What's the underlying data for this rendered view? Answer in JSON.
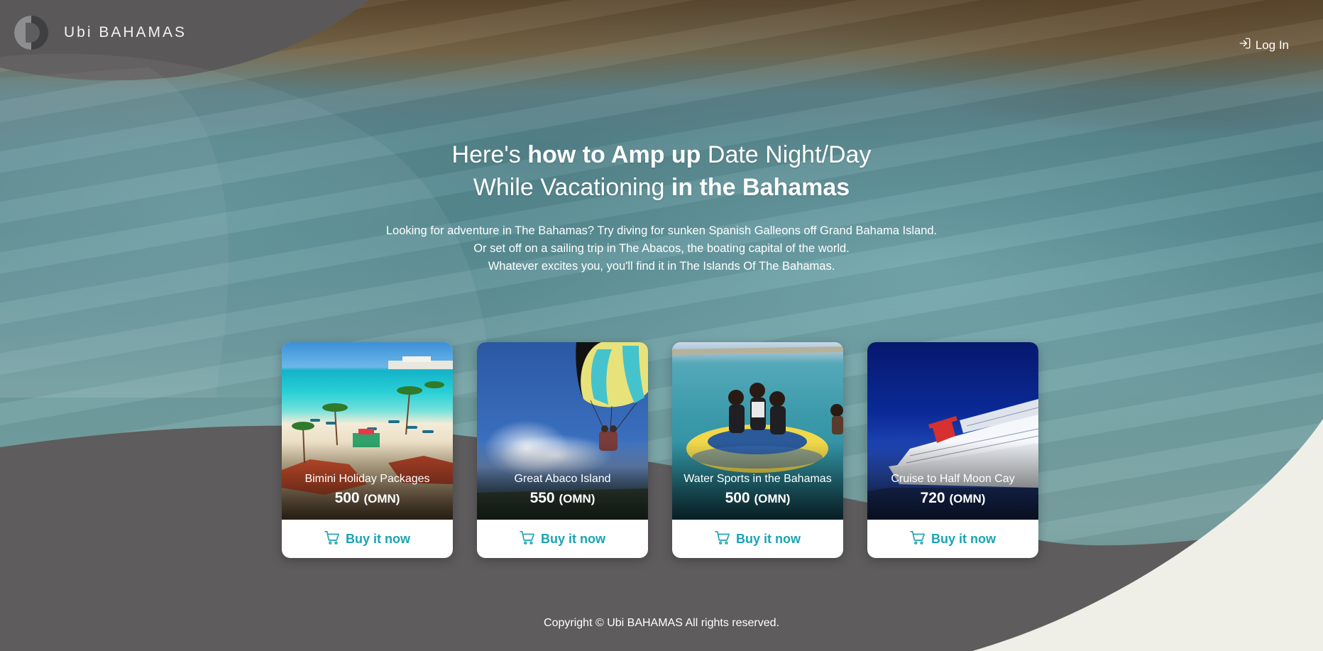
{
  "brand": {
    "name": "Ubi BAHAMAS"
  },
  "header": {
    "login_label": "Log In"
  },
  "hero": {
    "title_line1_pre": "Here's ",
    "title_line1_bold": "how to Amp up",
    "title_line1_post": " Date Night/Day",
    "title_line2_pre": "While Vacationing ",
    "title_line2_bold": "in the Bahamas",
    "desc_lines": [
      "Looking for adventure in The Bahamas? Try diving for sunken Spanish Galleons off Grand Bahama Island.",
      "Or set off on a sailing trip in The Abacos, the boating capital of the world.",
      "Whatever excites you, you'll find it in The Islands Of The Bahamas."
    ]
  },
  "cards": [
    {
      "title": "Bimini Holiday Packages",
      "price": "500",
      "currency": "(OMN)",
      "buy_label": "Buy it now",
      "image": "beach-resort"
    },
    {
      "title": "Great Abaco Island",
      "price": "550",
      "currency": "(OMN)",
      "buy_label": "Buy it now",
      "image": "parasailing"
    },
    {
      "title": "Water Sports in the Bahamas",
      "price": "500",
      "currency": "(OMN)",
      "buy_label": "Buy it now",
      "image": "tube-riders"
    },
    {
      "title": "Cruise to Half Moon Cay",
      "price": "720",
      "currency": "(OMN)",
      "buy_label": "Buy it now",
      "image": "cruise-ship"
    }
  ],
  "footer": {
    "copyright": "Copyright © Ubi BAHAMAS All rights reserved."
  },
  "colors": {
    "accent": "#1ba3b3",
    "dark_band": "#5e5c5d",
    "light_corner": "#efefe8"
  },
  "icons": {
    "login": "login-icon",
    "cart": "cart-icon"
  }
}
